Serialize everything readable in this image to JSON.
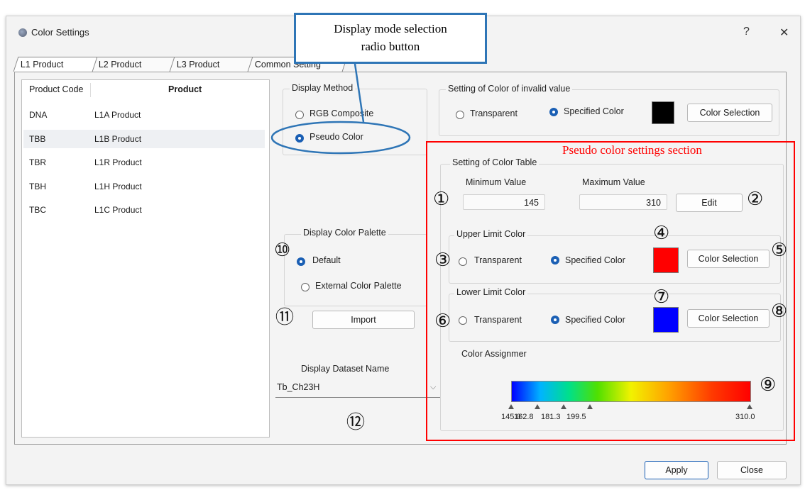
{
  "window": {
    "title": "Color Settings",
    "help": "?",
    "close": "✕"
  },
  "tabs": [
    "L1 Product",
    "L2 Product",
    "L3 Product",
    "Common Setting"
  ],
  "product_table": {
    "headers": [
      "Product Code",
      "Product"
    ],
    "rows": [
      {
        "code": "DNA",
        "product": "L1A Product"
      },
      {
        "code": "TBB",
        "product": "L1B Product"
      },
      {
        "code": "TBR",
        "product": "L1R Product"
      },
      {
        "code": "TBH",
        "product": "L1H Product"
      },
      {
        "code": "TBC",
        "product": "L1C Product"
      }
    ],
    "selected_row": 1
  },
  "display_method": {
    "label": "Display Method",
    "options": [
      "RGB Composite",
      "Pseudo Color"
    ],
    "selected": "Pseudo Color"
  },
  "invalid_color": {
    "label": "Setting of Color of invalid value",
    "transparent": "Transparent",
    "specified": "Specified Color",
    "button": "Color Selection",
    "swatch": "#000000"
  },
  "color_table": {
    "label": "Setting of Color Table",
    "min_label": "Minimum Value",
    "min_value": "145",
    "max_label": "Maximum Value",
    "max_value": "310",
    "edit_button": "Edit",
    "upper": {
      "label": "Upper Limit Color",
      "transparent": "Transparent",
      "specified": "Specified Color",
      "button": "Color Selection",
      "swatch": "#ff0000"
    },
    "lower": {
      "label": "Lower Limit Color",
      "transparent": "Transparent",
      "specified": "Specified Color",
      "button": "Color Selection",
      "swatch": "#0000ff"
    },
    "assigner_label": "Color Assignmer",
    "ticks": [
      {
        "value": 0.0,
        "label": "145.0"
      },
      {
        "value": 0.11,
        "label": "162.8"
      },
      {
        "value": 0.22,
        "label": "181.3"
      },
      {
        "value": 0.33,
        "label": "199.5"
      },
      {
        "value": 1.0,
        "label": "310.0"
      }
    ]
  },
  "palette": {
    "label": "Display Color Palette",
    "options": [
      "Default",
      "External Color Palette"
    ],
    "selected": "Default",
    "import_button": "Import"
  },
  "dataset": {
    "label": "Display Dataset Name",
    "value": "Tb_Ch23H"
  },
  "footer": {
    "apply": "Apply",
    "close": "Close"
  },
  "annotations": {
    "callout": [
      "Display mode selection",
      "radio button"
    ],
    "section": "Pseudo color settings section",
    "colors": {
      "callout": "#2e75b6",
      "section": "#ff0000"
    },
    "numbers": [
      "①",
      "②",
      "③",
      "④",
      "⑤",
      "⑥",
      "⑦",
      "⑧",
      "⑨",
      "⑩",
      "⑪",
      "⑫"
    ]
  }
}
